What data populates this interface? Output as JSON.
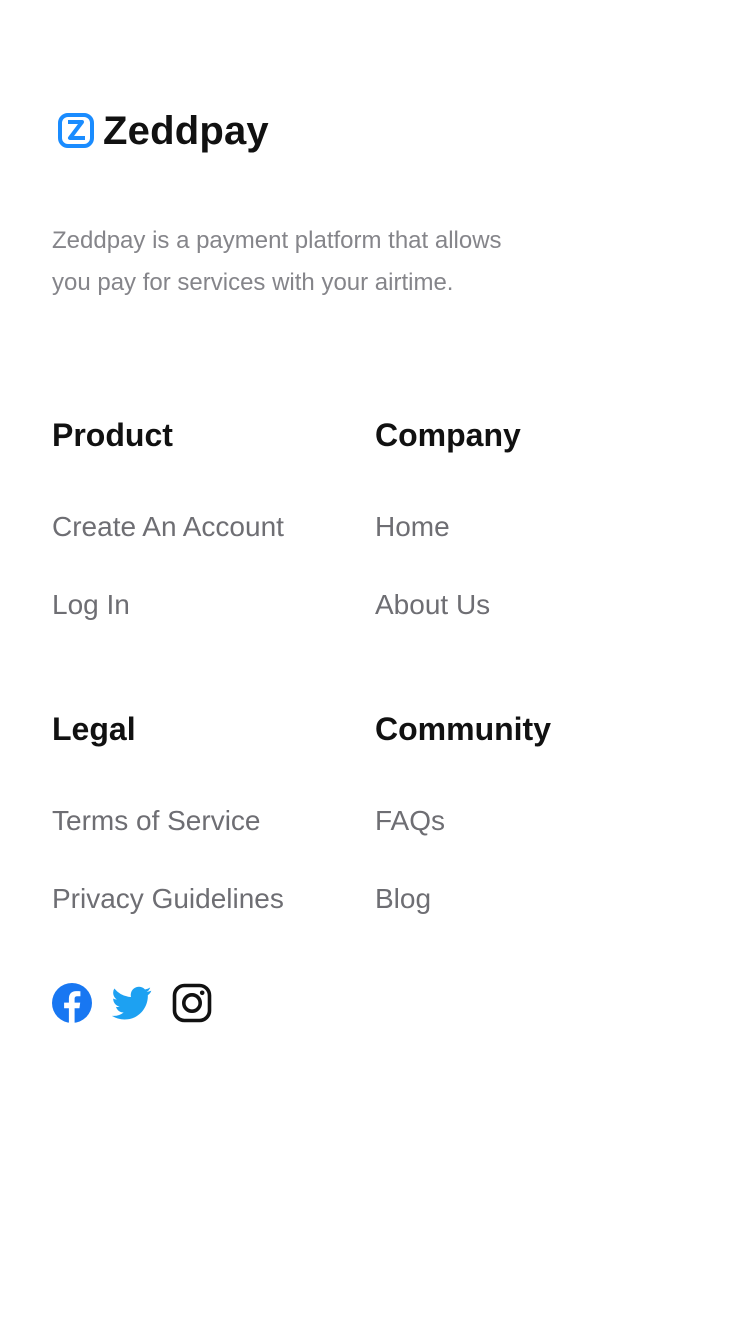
{
  "brand": {
    "name": "Zeddpay",
    "accent_color": "#1a8cff"
  },
  "tagline": "Zeddpay is a payment platform that allows you pay for services with your airtime.",
  "columns": {
    "product": {
      "title": "Product",
      "links": [
        "Create An Account",
        "Log In"
      ]
    },
    "company": {
      "title": "Company",
      "links": [
        "Home",
        "About Us"
      ]
    },
    "legal": {
      "title": "Legal",
      "links": [
        "Terms of Service",
        "Privacy Guidelines"
      ]
    },
    "community": {
      "title": "Community",
      "links": [
        "FAQs",
        "Blog"
      ]
    }
  },
  "socials": [
    {
      "icon": "facebook-icon",
      "color": "#1877f2"
    },
    {
      "icon": "twitter-icon",
      "color": "#1da1f2"
    },
    {
      "icon": "instagram-icon",
      "color": "#111111"
    }
  ]
}
